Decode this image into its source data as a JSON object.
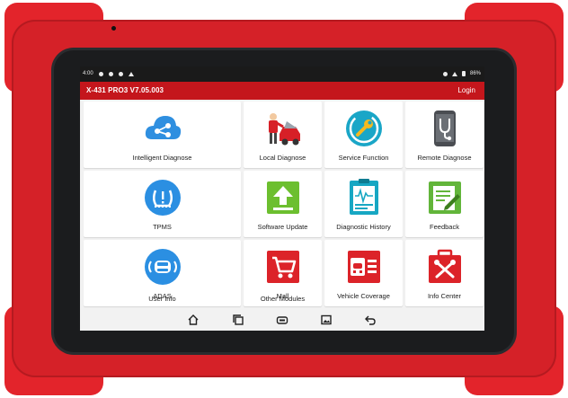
{
  "status_bar": {
    "time": "4:00",
    "battery": "86%"
  },
  "header": {
    "title": "X-431 PRO3 V7.05.003",
    "login_label": "Login"
  },
  "modules": [
    {
      "label": "Intelligent Diagnose",
      "icon": "cloud-share-icon"
    },
    {
      "label": "Local Diagnose",
      "icon": "mechanic-car-icon"
    },
    {
      "label": "Service Function",
      "icon": "wrench-circle-icon"
    },
    {
      "label": "Remote Diagnose",
      "icon": "stethoscope-phone-icon"
    },
    {
      "label": "TPMS",
      "icon": "tire-pressure-icon"
    },
    {
      "label": "Software Update",
      "icon": "upload-arrow-icon"
    },
    {
      "label": "Diagnostic History",
      "icon": "clipboard-waveform-icon"
    },
    {
      "label": "Feedback",
      "icon": "note-pencil-icon"
    },
    {
      "label": "ADAS",
      "icon": "car-radar-icon"
    },
    {
      "label": "Mall",
      "icon": "shopping-cart-icon"
    },
    {
      "label": "Vehicle Coverage",
      "icon": "car-list-icon"
    },
    {
      "label": "Info Center",
      "icon": "toolbox-icon"
    },
    {
      "label": "User Info",
      "icon": "user-circle-icon"
    },
    {
      "label": "Other Modules",
      "icon": "grid-squares-icon"
    }
  ],
  "nav_bar": [
    "home-icon",
    "recent-apps-icon",
    "vci-icon",
    "screenshot-icon",
    "back-icon"
  ],
  "colors": {
    "brand_red": "#c4161c",
    "bumper_red": "#e3242b"
  }
}
